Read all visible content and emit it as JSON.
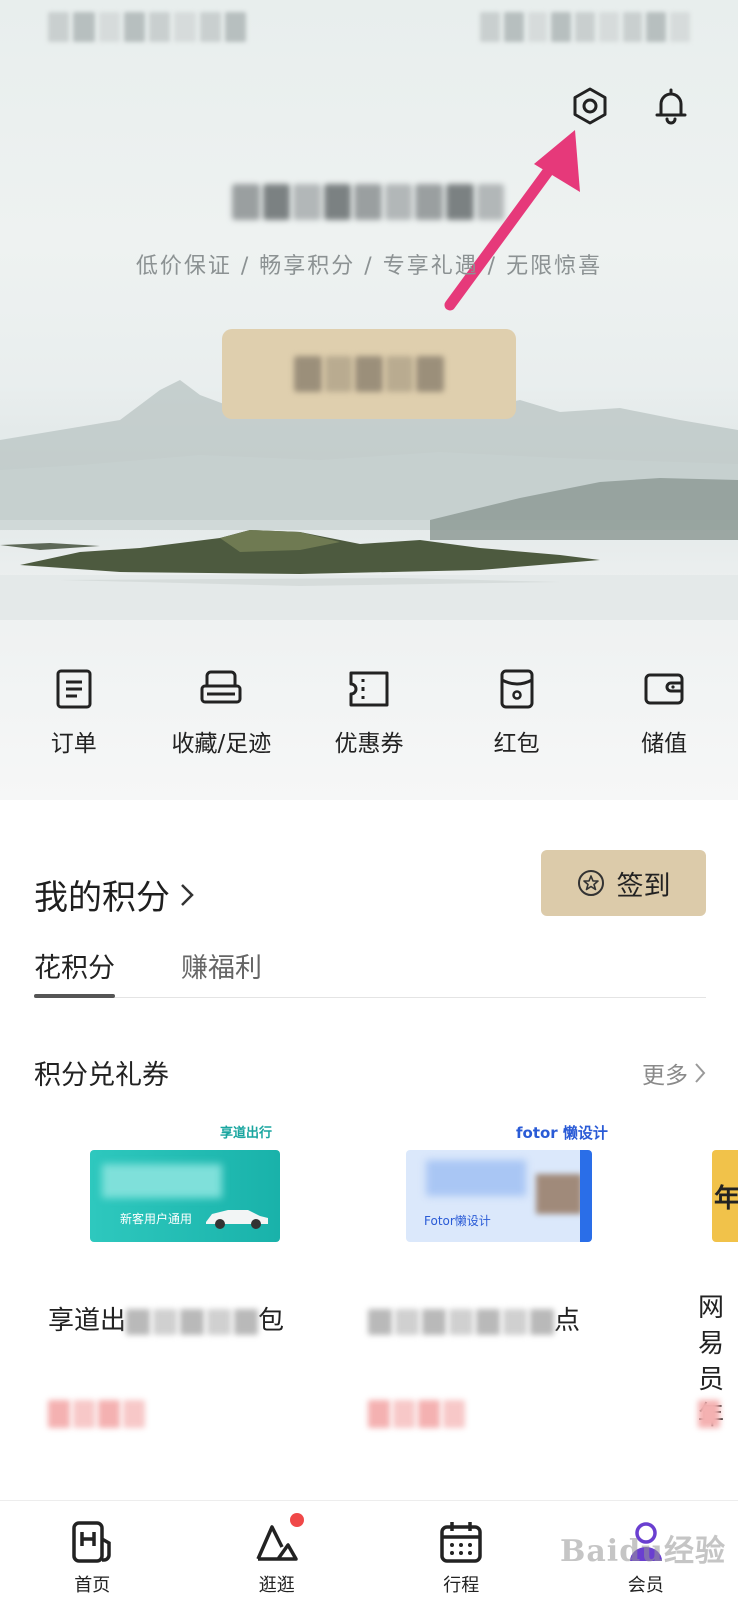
{
  "header": {
    "settings_icon": "gear-hexagon-icon",
    "bell_icon": "bell-icon",
    "slogan": "低价保证 / 畅享积分 / 专享礼遇 / 无限惊喜"
  },
  "quick_actions": [
    {
      "label": "订单",
      "icon": "order-list-icon"
    },
    {
      "label": "收藏/足迹",
      "icon": "sofa-icon"
    },
    {
      "label": "优惠券",
      "icon": "ticket-icon"
    },
    {
      "label": "红包",
      "icon": "red-packet-icon"
    },
    {
      "label": "储值",
      "icon": "wallet-icon"
    }
  ],
  "points": {
    "title": "我的积分",
    "signin_label": "签到",
    "tabs": [
      {
        "label": "花积分",
        "active": true
      },
      {
        "label": "赚福利",
        "active": false
      }
    ]
  },
  "section": {
    "title": "积分兑礼券",
    "more_label": "更多"
  },
  "cards": [
    {
      "brand": "享道出行",
      "coupon_text": "新客用户通用",
      "title_prefix": "享道出",
      "title_suffix": "包"
    },
    {
      "brand": "fotor 懒设计",
      "coupon_text": "Fotor懒设计",
      "title_prefix": "",
      "title_suffix": "点"
    },
    {
      "brand": "",
      "coupon_text": "年",
      "title_prefix": "网易",
      "title_suffix": "员年"
    }
  ],
  "bottom_nav": [
    {
      "label": "首页",
      "icon": "home-h-icon"
    },
    {
      "label": "逛逛",
      "icon": "mountain-icon"
    },
    {
      "label": "行程",
      "icon": "calendar-icon"
    },
    {
      "label": "会员",
      "icon": "member-icon"
    }
  ],
  "watermark": "Baidu经验",
  "colors": {
    "gold": "#dfcfae",
    "arrow": "#e6397a",
    "badge": "#f04848"
  }
}
